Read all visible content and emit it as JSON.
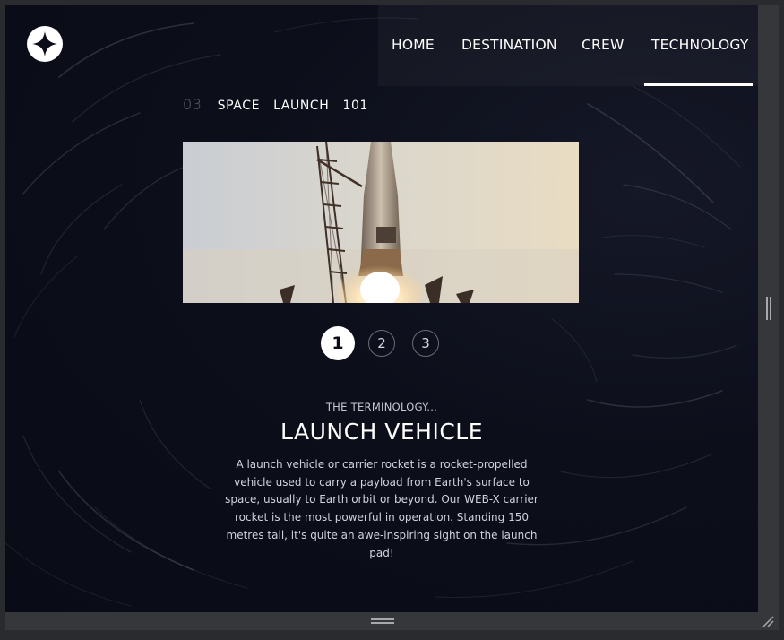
{
  "nav": {
    "items": [
      {
        "label": "HOME"
      },
      {
        "label": "DESTINATION"
      },
      {
        "label": "CREW"
      },
      {
        "label": "TECHNOLOGY",
        "active": true
      }
    ]
  },
  "page": {
    "number": "03",
    "heading_words": [
      "SPACE",
      "LAUNCH",
      "101"
    ]
  },
  "pagination": {
    "pages": [
      "1",
      "2",
      "3"
    ],
    "active_index": 0
  },
  "content": {
    "subtitle": "THE TERMINOLOGY...",
    "title": "LAUNCH VEHICLE",
    "description": "A launch vehicle or carrier rocket is a rocket-propelled vehicle used to carry a payload from Earth's surface to space, usually to Earth orbit or beyond. Our WEB-X carrier rocket is the most powerful in operation. Standing 150 metres tall, it's quite an awe-inspiring sight on the launch pad!"
  },
  "icons": {
    "logo": "star-logo-icon",
    "rail_handle": "vertical-resize-handle-icon",
    "bottom_handle": "horizontal-resize-handle-icon",
    "corner": "resize-corner-icon"
  },
  "colors": {
    "background": "#0b0d18",
    "accent": "#ffffff",
    "muted": "#5f6270"
  }
}
